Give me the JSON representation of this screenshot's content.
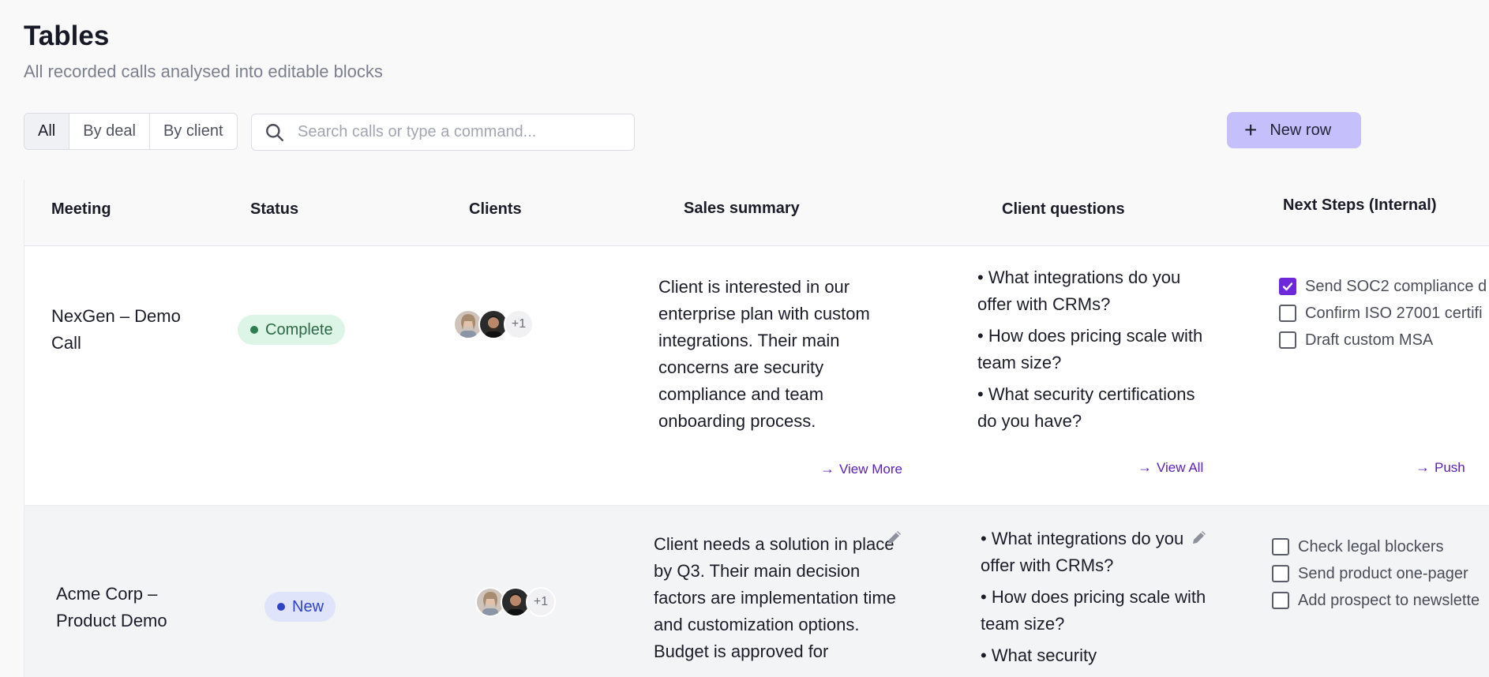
{
  "page": {
    "title": "Tables",
    "subtitle": "All recorded calls analysed into editable blocks"
  },
  "filters": {
    "tabs": [
      "All",
      "By deal",
      "By client"
    ],
    "active": "All"
  },
  "search": {
    "placeholder": "Search calls or type a command...",
    "value": ""
  },
  "new_row_button": {
    "label": "New row"
  },
  "table": {
    "columns": [
      "Meeting",
      "Status",
      "Clients",
      "Sales summary",
      "Client questions",
      "Next Steps (Internal)"
    ],
    "rows": [
      {
        "meeting": "NexGen – Demo Call",
        "status": "Complete",
        "clients_more": "+1",
        "summary": "Client is interested in our enterprise plan with custom integrations. Their main concerns are security compliance and team onboarding process.",
        "summary_link": "View More",
        "questions": [
          "• What integrations do you offer with CRMs?",
          "• How does pricing scale with team size?",
          "• What security certifications do you have?"
        ],
        "questions_link": "View All",
        "next_steps": [
          {
            "label": "Send SOC2 compliance d",
            "checked": true
          },
          {
            "label": "Confirm ISO 27001 certifi",
            "checked": false
          },
          {
            "label": "Draft custom MSA",
            "checked": false
          }
        ],
        "next_link": "Push"
      },
      {
        "meeting": "Acme Corp – Product Demo",
        "status": "New",
        "clients_more": "+1",
        "summary": "Client needs a solution in place by Q3. Their main decision factors are implementation time and customization options. Budget is approved for",
        "questions": [
          "• What integrations do you offer with CRMs?",
          "• How does pricing scale with team size?",
          "• What security"
        ],
        "next_steps": [
          {
            "label": "Check legal blockers",
            "checked": false
          },
          {
            "label": "Send product one-pager",
            "checked": false
          },
          {
            "label": "Add prospect to newslette",
            "checked": false
          }
        ]
      }
    ]
  },
  "colors": {
    "accent": "#6d28d9",
    "new_row_bg": "#c5c0fb",
    "complete_bg": "#dcf5e6",
    "new_bg": "#dfe4fb"
  }
}
